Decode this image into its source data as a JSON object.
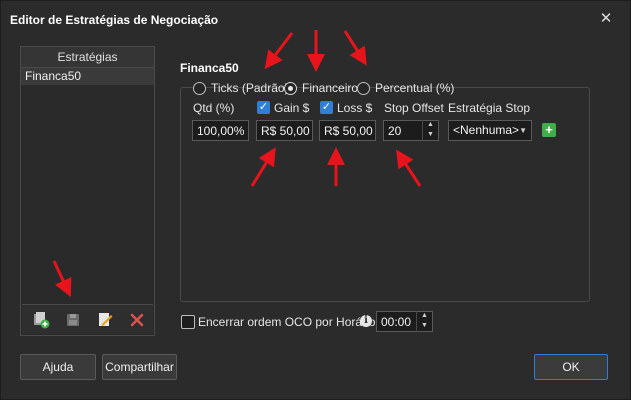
{
  "window": {
    "title": "Editor de Estratégias de Negociação",
    "close_glyph": "✕"
  },
  "strategies": {
    "header": "Estratégias",
    "items": [
      "Financa50"
    ],
    "toolbar_icons": [
      "add-strategy-icon",
      "save-icon",
      "edit-icon",
      "delete-icon"
    ]
  },
  "editor": {
    "strategy_name": "Financa50",
    "modes": [
      {
        "label": "Ticks (Padrão)",
        "selected": false
      },
      {
        "label": "Financeiro",
        "selected": true
      },
      {
        "label": "Percentual (%)",
        "selected": false
      }
    ],
    "qtd": {
      "label": "Qtd (%)",
      "value": "100,00%"
    },
    "gain": {
      "label": "Gain $",
      "checked": true,
      "value": "R$ 50,00"
    },
    "loss": {
      "label": "Loss $",
      "checked": true,
      "value": "R$ 50,00"
    },
    "stop_offset": {
      "label": "Stop Offset",
      "value": "20"
    },
    "stop_strategy": {
      "label": "Estratégia Stop",
      "value": "<Nenhuma>"
    },
    "oco": {
      "label": "Encerrar ordem OCO por Horário",
      "checked": false,
      "time": "00:00"
    }
  },
  "buttons": {
    "help": "Ajuda",
    "share": "Compartilhar",
    "ok": "OK"
  },
  "colors": {
    "accent": "#2f7fd6",
    "annotation_arrow": "#e8141b",
    "add_green": "#3fae49",
    "delete_red": "#d9534f"
  }
}
